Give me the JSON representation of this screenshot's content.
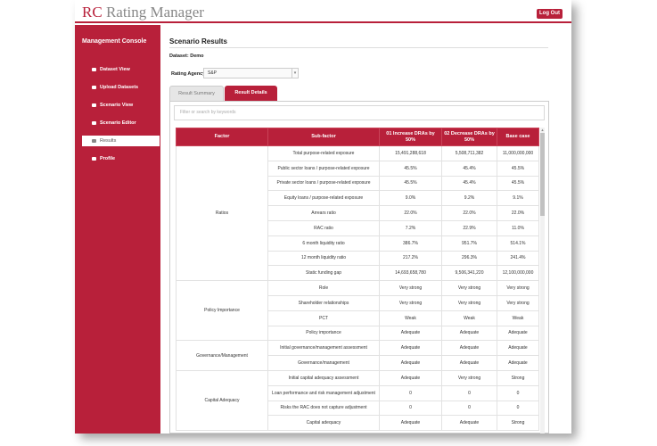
{
  "app": {
    "brand_rc": "RC",
    "brand_rest": "Rating Manager",
    "logout_label": "Log Out"
  },
  "colors": {
    "accent": "#b8203a"
  },
  "sidebar": {
    "title": "Management Console",
    "items": [
      {
        "label": "Dataset View",
        "icon": "table-icon"
      },
      {
        "label": "Upload Datasets",
        "icon": "upload-icon"
      },
      {
        "label": "Scenario View",
        "icon": "eye-icon"
      },
      {
        "label": "Scenario Editor",
        "icon": "edit-icon"
      },
      {
        "label": "Results",
        "icon": "list-icon",
        "active": true
      },
      {
        "label": "Profile",
        "icon": "user-icon"
      }
    ]
  },
  "main": {
    "title": "Scenario Results",
    "dataset": "Dataset: Demo",
    "agency_label": "Rating Agency",
    "agency_value": "S&P",
    "tabs": [
      {
        "label": "Result Summary"
      },
      {
        "label": "Result Details"
      }
    ],
    "filter_placeholder": "Filter or search by keywords"
  },
  "table": {
    "headers": [
      "Factor",
      "Sub-factor",
      "01 Increase DRAs by 50%",
      "02 Decrease DRAs by 50%",
      "Base case"
    ],
    "groups": [
      {
        "factor": "Ratios",
        "rows": [
          [
            "Total purpose-related exposure",
            "15,491,288,618",
            "5,508,711,382",
            "11,000,000,000"
          ],
          [
            "Public sector loans / purpose-related exposure",
            "45.5%",
            "45.4%",
            "45.5%"
          ],
          [
            "Private sector loans / purpose-related exposure",
            "45.5%",
            "45.4%",
            "45.5%"
          ],
          [
            "Equity loans / purpose-related exposure",
            "9.0%",
            "9.2%",
            "9.1%"
          ],
          [
            "Arrears ratio",
            "22.0%",
            "22.0%",
            "22.0%"
          ],
          [
            "RAC ratio",
            "7.2%",
            "22.9%",
            "11.0%"
          ],
          [
            "6 month liquidity ratio",
            "386.7%",
            "951.7%",
            "514.1%"
          ],
          [
            "12 month liquidity ratio",
            "217.2%",
            "296.3%",
            "241.4%"
          ],
          [
            "Static funding gap",
            "14,693,658,780",
            "9,506,341,220",
            "12,100,000,000"
          ]
        ]
      },
      {
        "factor": "Policy Importance",
        "rows": [
          [
            "Role",
            "Very strong",
            "Very strong",
            "Very strong"
          ],
          [
            "Shareholder relationships",
            "Very strong",
            "Very strong",
            "Very strong"
          ],
          [
            "PCT",
            "Weak",
            "Weak",
            "Weak"
          ],
          [
            "Policy importance",
            "Adequate",
            "Adequate",
            "Adequate"
          ]
        ]
      },
      {
        "factor": "Governance/Management",
        "rows": [
          [
            "Initial governance/management assessment",
            "Adequate",
            "Adequate",
            "Adequate"
          ],
          [
            "Governance/management",
            "Adequate",
            "Adequate",
            "Adequate"
          ]
        ]
      },
      {
        "factor": "Capital Adequacy",
        "rows": [
          [
            "Initial capital adequacy assessment",
            "Adequate",
            "Very strong",
            "Strong"
          ],
          [
            "Loan performance and risk management adjustment",
            "0",
            "0",
            "0"
          ],
          [
            "Risks the RAC does not capture adjustment",
            "0",
            "0",
            "0"
          ],
          [
            "Capital adequacy",
            "Adequate",
            "Adequate",
            "Strong"
          ]
        ]
      }
    ]
  }
}
